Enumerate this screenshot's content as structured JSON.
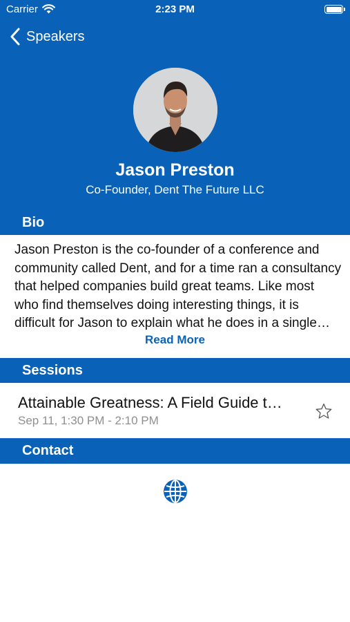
{
  "status_bar": {
    "carrier": "Carrier",
    "time": "2:23 PM"
  },
  "nav": {
    "back_label": "Speakers"
  },
  "speaker": {
    "name": "Jason Preston",
    "title": "Co-Founder, Dent The Future LLC"
  },
  "bio": {
    "header": "Bio",
    "text": "Jason Preston is the co-founder of a conference and community called Dent, and for a time ran a consultancy that helped companies build great teams. Like most who find themselves doing interesting things, it is difficult for Jason to explain what he does in a single sentence.",
    "read_more": "Read More"
  },
  "sessions": {
    "header": "Sessions",
    "items": [
      {
        "title": "Attainable Greatness: A Field Guide to Building Great Teams",
        "time": "Sep 11, 1:30 PM - 2:10 PM",
        "favorited": false
      }
    ]
  },
  "contact": {
    "header": "Contact",
    "links": [
      "globe-icon"
    ]
  },
  "colors": {
    "primary": "#0a62b8",
    "secondary_text": "#8e8e93"
  }
}
